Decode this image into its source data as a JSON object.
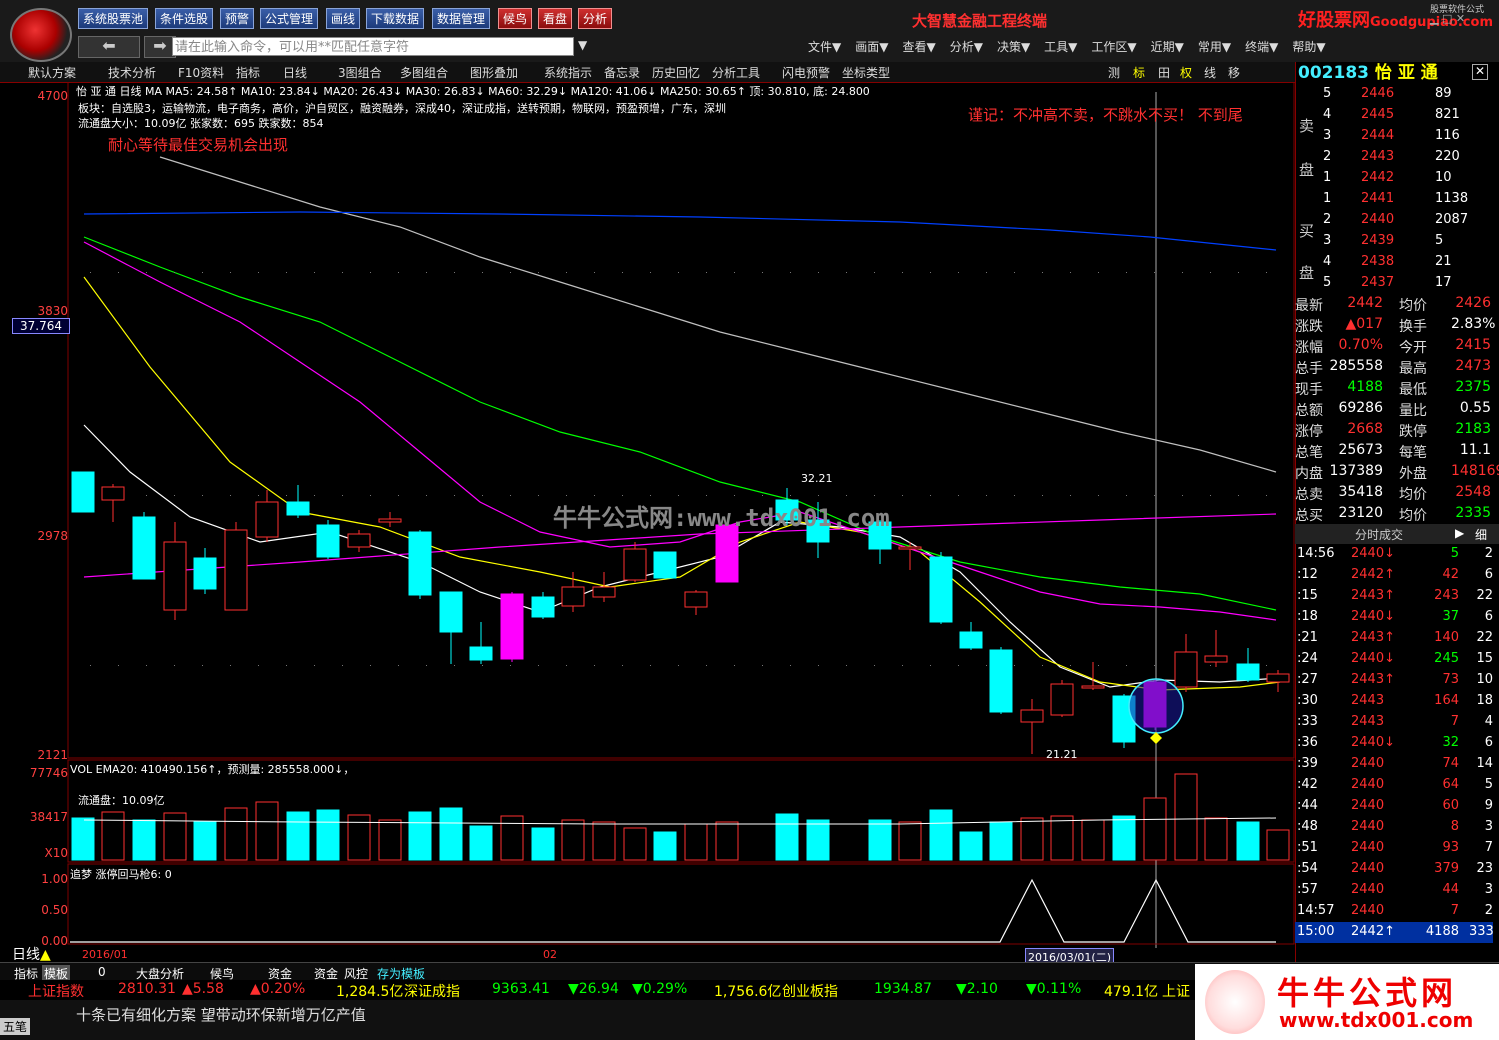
{
  "toolbar": {
    "buttons": [
      "系统股票池",
      "条件选股",
      "预警",
      "公式管理",
      "画线",
      "下载数据",
      "数据管理",
      "候鸟",
      "看盘",
      "分析"
    ],
    "brand": "大智慧金融工程终端",
    "command_placeholder": "请在此输入命令，可以用**匹配任意字符",
    "menu": [
      "文件▼",
      "画面▼",
      "查看▼",
      "分析▼",
      "决策▼",
      "工具▼",
      "工作区▼",
      "近期▼",
      "常用▼",
      "终端▼",
      "帮助▼"
    ],
    "site_logo": "好股票网",
    "site_logo_en": "Goodgupiao.com",
    "site_small": "股票软件公式"
  },
  "bar2": {
    "items": [
      "默认方案",
      "技术分析",
      "F10资料",
      "指标",
      "日线",
      "3图组合",
      "多图组合",
      "图形叠加",
      "系统指示",
      "备忘录",
      "历史回忆",
      "分析工具",
      "闪电预警",
      "坐标类型"
    ],
    "right": [
      "测",
      "标",
      "田",
      "权",
      "线",
      "移"
    ]
  },
  "chart": {
    "stock_line": "怡 亚 通 日线  MA  MA5: 24.58↑ MA10: 23.84↓ MA20: 26.43↓ MA30: 26.83↓ MA60: 32.29↓ MA120: 41.06↓ MA250: 30.65↑ 顶: 30.810, 底: 24.800",
    "sector": "板块：自选股3，运输物流，电子商务，高价，沪自贸区，融资融券，深成40，深证成指，送转预期，物联网，预盈预增，广东，深圳",
    "float_line": "流通盘大小：10.09亿   张家数：695   跌家数：854",
    "patience": "耐心等待最佳交易机会出现",
    "warning": "谨记：不冲高不卖，不跳水不买！   不到尾",
    "y_labels": [
      "4700",
      "3830",
      "2978",
      "2121"
    ],
    "current_price": "37.764",
    "high_label": "32.21",
    "low_label": "21.21",
    "watermark": "牛牛公式网:www.tdx001.com",
    "vol_line": "VOL  EMA20: 410490.156↑，预测量: 285558.000↓，",
    "vol_float": "流通盘：10.09亿",
    "vol_labels": [
      "77746",
      "38417",
      "X10"
    ],
    "ind_line": "追梦  涨停回马枪6: 0",
    "ind_labels": [
      "1.00",
      "0.50",
      "0.00"
    ],
    "x_labels": [
      "2016/01",
      "02",
      "2016/03/01(二)"
    ]
  },
  "right_panel": {
    "code": "002183",
    "name": "怡 亚 通",
    "sell_label": "卖盘",
    "buy_label": "买盘",
    "sell": [
      [
        "5",
        "2446",
        "89"
      ],
      [
        "4",
        "2445",
        "821"
      ],
      [
        "3",
        "2444",
        "116"
      ],
      [
        "2",
        "2443",
        "220"
      ],
      [
        "1",
        "2442",
        "10"
      ]
    ],
    "buy": [
      [
        "1",
        "2441",
        "1138"
      ],
      [
        "2",
        "2440",
        "2087"
      ],
      [
        "3",
        "2439",
        "5"
      ],
      [
        "4",
        "2438",
        "21"
      ],
      [
        "5",
        "2437",
        "17"
      ]
    ],
    "stats": [
      [
        "最新",
        "2442",
        "均价",
        "2426"
      ],
      [
        "涨跌",
        "▲017",
        "换手",
        "2.83%"
      ],
      [
        "涨幅",
        "0.70%",
        "今开",
        "2415"
      ],
      [
        "总手",
        "285558",
        "最高",
        "2473"
      ],
      [
        "现手",
        "4188",
        "最低",
        "2375"
      ],
      [
        "总额",
        "69286",
        "量比",
        "0.55"
      ],
      [
        "涨停",
        "2668",
        "跌停",
        "2183"
      ],
      [
        "总笔",
        "25673",
        "每笔",
        "11.1"
      ],
      [
        "内盘",
        "137389",
        "外盘",
        "148169"
      ],
      [
        "总卖",
        "35418",
        "均价",
        "2548"
      ],
      [
        "总买",
        "23120",
        "均价",
        "2335"
      ]
    ],
    "tick_header": "分时成交",
    "tick_fine": "细",
    "ticks": [
      [
        "14:56",
        "2440↓",
        "5",
        "2"
      ],
      [
        ":12",
        "2442↑",
        "42",
        "6"
      ],
      [
        ":15",
        "2443↑",
        "243",
        "22"
      ],
      [
        ":18",
        "2440↓",
        "37",
        "6"
      ],
      [
        ":21",
        "2443↑",
        "140",
        "22"
      ],
      [
        ":24",
        "2440↓",
        "245",
        "15"
      ],
      [
        ":27",
        "2443↑",
        "73",
        "10"
      ],
      [
        ":30",
        "2443",
        "164",
        "18"
      ],
      [
        ":33",
        "2443",
        "7",
        "4"
      ],
      [
        ":36",
        "2440↓",
        "32",
        "6"
      ],
      [
        ":39",
        "2440",
        "74",
        "14"
      ],
      [
        ":42",
        "2440",
        "64",
        "5"
      ],
      [
        ":44",
        "2440",
        "60",
        "9"
      ],
      [
        ":48",
        "2440",
        "8",
        "3"
      ],
      [
        ":51",
        "2440",
        "93",
        "7"
      ],
      [
        ":54",
        "2440",
        "379",
        "23"
      ],
      [
        ":57",
        "2440",
        "44",
        "3"
      ],
      [
        "14:57",
        "2440",
        "7",
        "2"
      ],
      [
        "15:00",
        "2442↑",
        "4188",
        "333"
      ]
    ]
  },
  "bottom": {
    "tabs": [
      "指标",
      "模板",
      "0",
      "大盘分析",
      "候鸟",
      "资金",
      "资金",
      "风控",
      "存为模板"
    ],
    "line_mode": "日线",
    "index1_name": "上证指数",
    "index1_val": "2810.31",
    "index1_chg": "▲5.58",
    "index1_pct": "▲0.20%",
    "index1_amt": "1,284.5亿",
    "index2_name": "深证成指",
    "index2_val": "9363.41",
    "index2_chg": "▼26.94",
    "index2_pct": "▼0.29%",
    "index2_amt": "1,756.6亿",
    "index3_name": "创业板指",
    "index3_val": "1934.87",
    "index3_chg": "▼2.10",
    "index3_pct": "▼0.11%",
    "index3_amt": "479.1亿",
    "index4_name": "上证",
    "news": "十条已有细化方案 望带动环保新增万亿产值",
    "input_mode": "五笔",
    "site_cn": "牛牛公式网",
    "site_url": "www.tdx001.com"
  },
  "colors": {
    "up": "#ff3030",
    "down": "#00ffff",
    "ma5": "#ffffff",
    "ma10": "#ffff00",
    "ma20": "#ff00ff",
    "ma30": "#00ff00",
    "ma60": "#c0c0c0",
    "ma120": "#0040ff",
    "ma250": "#ff00ff"
  }
}
